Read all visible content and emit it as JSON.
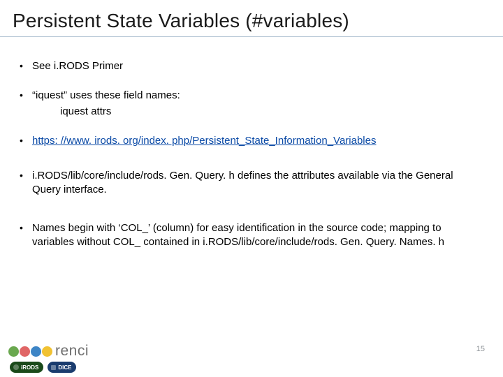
{
  "title": "Persistent State Variables (#variables)",
  "bullets": [
    {
      "text": "See i.RODS Primer",
      "sub": null,
      "link": false
    },
    {
      "text": "“iquest” uses these field names:",
      "sub": "iquest attrs",
      "link": false
    },
    {
      "text": "https: //www. irods. org/index. php/Persistent_State_Information_Variables",
      "sub": null,
      "link": true
    },
    {
      "text": "i.RODS/lib/core/include/rods. Gen. Query. h   defines the attributes available via the General Query interface.",
      "sub": null,
      "link": false
    },
    {
      "text": "Names begin with ‘COL_’ (column) for easy identification in the source code; mapping to variables without COL_ contained in i.RODS/lib/core/include/rods. Gen. Query. Names. h",
      "sub": null,
      "link": false
    }
  ],
  "page_number": "15",
  "logos": {
    "renci_text": "renci",
    "renci_colors": [
      "#6aa84f",
      "#e06666",
      "#3d85c6",
      "#f1c232"
    ],
    "badges": [
      {
        "label": "iRODS",
        "kind": "irods"
      },
      {
        "label": "DICE",
        "kind": "dice"
      }
    ]
  }
}
